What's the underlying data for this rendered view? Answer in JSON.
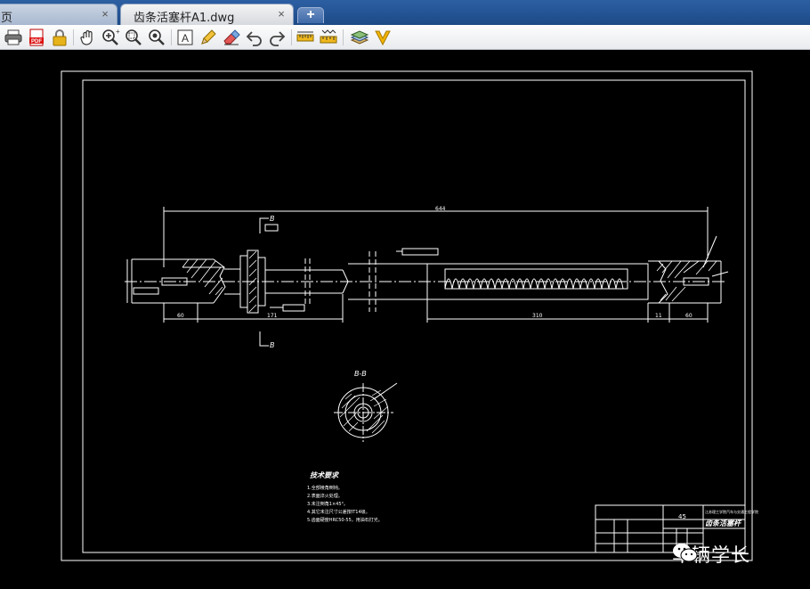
{
  "tabs": [
    {
      "label": "页",
      "active": false
    },
    {
      "label": "齿条活塞杆A1.dwg",
      "active": true
    }
  ],
  "new_tab_label": "+",
  "close_glyph": "×",
  "toolbar": [
    "print-icon",
    "pdf-icon",
    "lock-icon",
    "pan-icon",
    "zoom-in-icon",
    "zoom-window-icon",
    "zoom-extents-icon",
    "text-icon",
    "pencil-icon",
    "eraser-icon",
    "undo-icon",
    "redo-icon",
    "measure-icon",
    "measure-area-icon",
    "layers-icon",
    "check-v-icon"
  ],
  "drawing": {
    "section_label": "B-B",
    "cut_mark": "B",
    "dim_total": "644",
    "dim_left": "60",
    "dim_mid": "171",
    "dim_rack": "310",
    "dim_right_small": "11",
    "dim_right": "60",
    "notes_title": "技术要求",
    "notes": [
      "1.全部棱角倒钝。",
      "2.表面淬火处理。",
      "3.未注倒角1×45°。",
      "4.其它未注尺寸公差按IT14级。",
      "5.齿面硬度HRC50-55，用油石打光。"
    ],
    "title_block": {
      "material": "45",
      "part_name": "齿条活塞杆",
      "school": "江苏理工学院汽车与交通工程学院"
    }
  },
  "watermark": {
    "text": "车辆学长"
  },
  "colors": {
    "tabbar": "#2c5fa3",
    "canvas": "#000000",
    "lines": "#ffffff"
  }
}
